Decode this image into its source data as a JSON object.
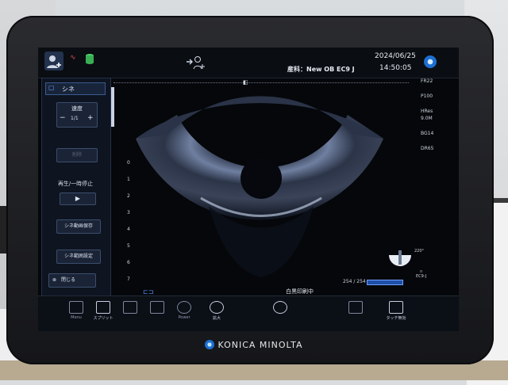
{
  "header": {
    "patient_icon": "patient-add-icon",
    "center_icon": "patient-transfer-icon",
    "exam_label": "産科：New OB EC9 J",
    "date": "2024/06/25",
    "time": "14:50:05",
    "logo_icon": "konica-minolta-logo"
  },
  "left_panel": {
    "tab_label": "シネ",
    "speed_label": "速度",
    "speed_value": "1/1",
    "minus": "−",
    "plus": "+",
    "button_disabled": "削除",
    "play_label": "再生/一時停止",
    "play_symbol": "▶",
    "save_button": "シネ動画保存",
    "range_button": "シネ範囲設定",
    "close_button": "閉じる"
  },
  "depth_scale": [
    "0",
    "1",
    "2",
    "3",
    "4",
    "5",
    "6",
    "7"
  ],
  "params": [
    "FR22",
    "P100",
    "HRes",
    "9.0M",
    "BG14",
    "DR65"
  ],
  "probe": {
    "angle": "220°",
    "counter": "254 / 254",
    "probe_name": "EC9-J"
  },
  "status": {
    "printing_text": "白黒印刷中"
  },
  "bottom_bar": [
    {
      "label": "Menu",
      "icon": "menu-icon"
    },
    {
      "label": "スプリット",
      "icon": "split-icon"
    },
    {
      "label": "",
      "icon": "layout-icon"
    },
    {
      "label": "",
      "icon": "layout2-icon"
    },
    {
      "label": "Power",
      "icon": "power-icon"
    },
    {
      "label": "拡大",
      "icon": "zoom-icon"
    },
    {
      "label": "",
      "icon": "rotate-icon"
    },
    {
      "label": "",
      "icon": "grid-icon"
    },
    {
      "label": "タッチ無効",
      "icon": "touch-disable-icon"
    }
  ],
  "monitor": {
    "brand": "KONICA MINOLTA"
  }
}
